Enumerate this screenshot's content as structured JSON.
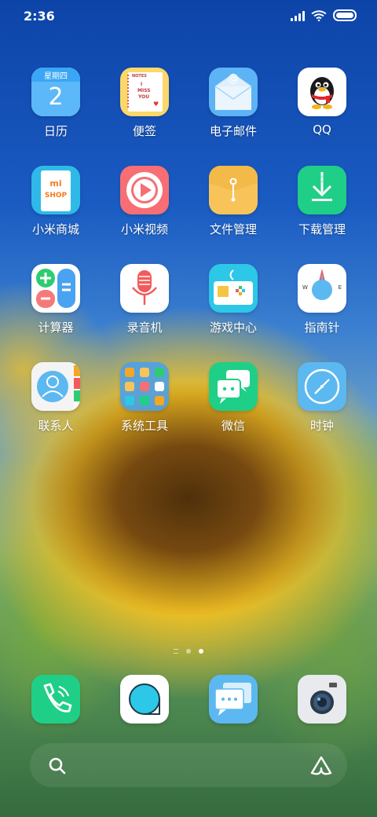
{
  "status_bar": {
    "time": "2:36"
  },
  "apps": [
    {
      "label": "日历",
      "weekday": "星期四",
      "day": "2"
    },
    {
      "label": "便签",
      "note_lines": [
        "NOTES",
        "I",
        "MISS",
        "YOU"
      ]
    },
    {
      "label": "电子邮件",
      "at": "@"
    },
    {
      "label": "QQ"
    },
    {
      "label": "小米商城",
      "logo": "mi",
      "shop": "SHOP"
    },
    {
      "label": "小米视频"
    },
    {
      "label": "文件管理"
    },
    {
      "label": "下载管理"
    },
    {
      "label": "计算器"
    },
    {
      "label": "录音机"
    },
    {
      "label": "游戏中心"
    },
    {
      "label": "指南针",
      "w": "W",
      "e": "E"
    },
    {
      "label": "联系人"
    },
    {
      "label": "系统工具"
    },
    {
      "label": "微信"
    },
    {
      "label": "时钟"
    }
  ],
  "dock": [
    {
      "name": "phone",
      "icon": "phone-icon"
    },
    {
      "name": "browser",
      "icon": "browser-icon"
    },
    {
      "name": "messages",
      "icon": "messages-icon"
    },
    {
      "name": "camera",
      "icon": "camera-icon"
    }
  ],
  "page_indicator": {
    "pages": 3,
    "current": 3
  }
}
